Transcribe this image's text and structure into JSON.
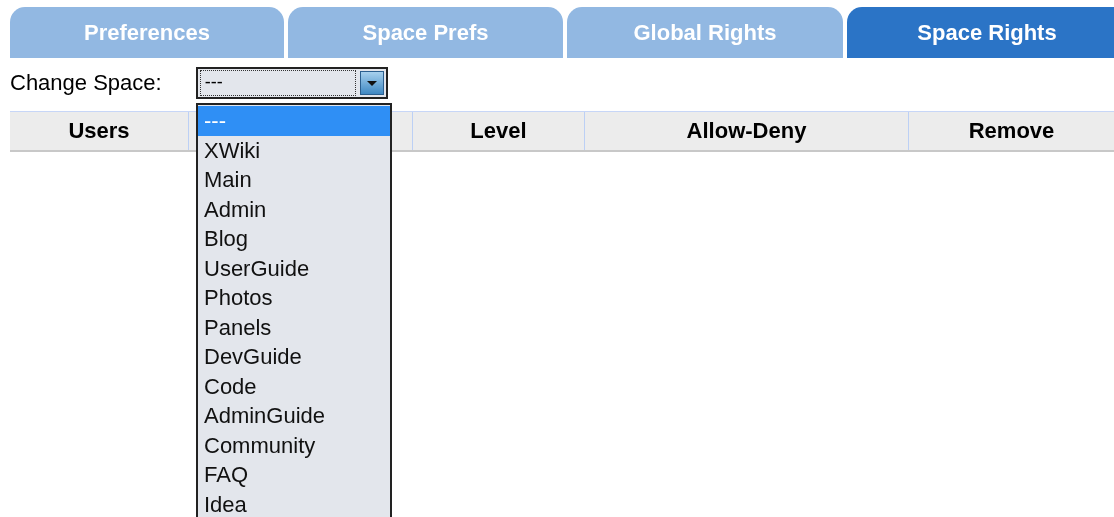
{
  "tabs": [
    {
      "label": "Preferences",
      "selected": false
    },
    {
      "label": "Space Prefs",
      "selected": false
    },
    {
      "label": "Global Rights",
      "selected": false
    },
    {
      "label": "Space Rights",
      "selected": true
    }
  ],
  "change_space": {
    "label": "Change Space:",
    "value": "---",
    "expanded": true,
    "options": [
      {
        "label": "---",
        "selected": true
      },
      {
        "label": "XWiki",
        "selected": false
      },
      {
        "label": "Main",
        "selected": false
      },
      {
        "label": "Admin",
        "selected": false
      },
      {
        "label": "Blog",
        "selected": false
      },
      {
        "label": "UserGuide",
        "selected": false
      },
      {
        "label": "Photos",
        "selected": false
      },
      {
        "label": "Panels",
        "selected": false
      },
      {
        "label": "DevGuide",
        "selected": false
      },
      {
        "label": "Code",
        "selected": false
      },
      {
        "label": "AdminGuide",
        "selected": false
      },
      {
        "label": "Community",
        "selected": false
      },
      {
        "label": "FAQ",
        "selected": false
      },
      {
        "label": "Idea",
        "selected": false
      }
    ]
  },
  "table": {
    "columns": [
      "Users",
      "Level",
      "Allow-Deny",
      "Remove"
    ]
  }
}
